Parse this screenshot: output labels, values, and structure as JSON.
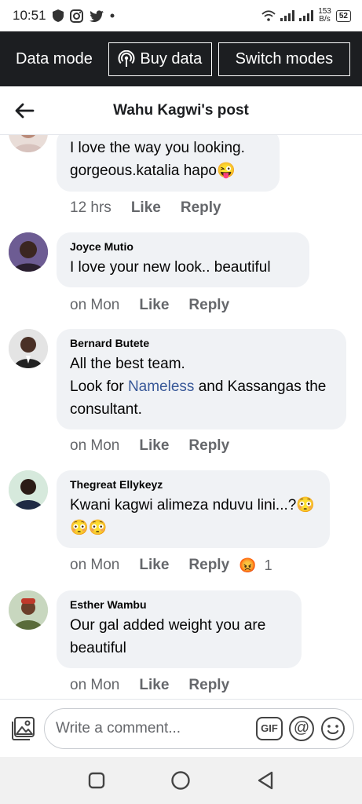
{
  "status_bar": {
    "time": "10:51",
    "speed_value": "153",
    "speed_unit": "B/s",
    "battery": "52"
  },
  "data_bar": {
    "label": "Data mode",
    "buy_data": "Buy data",
    "switch_modes": "Switch modes"
  },
  "header": {
    "title": "Wahu Kagwi's post"
  },
  "comments": [
    {
      "name": "",
      "text": "I love the way you looking. gorgeous.katalia hapo😜",
      "time": "12 hrs",
      "like": "Like",
      "reply": "Reply"
    },
    {
      "name": "Joyce Mutio",
      "text": "I love your new look.. beautiful",
      "time": "on Mon",
      "like": "Like",
      "reply": "Reply"
    },
    {
      "name": "Bernard Butete",
      "text_before": "All the best team.",
      "text_prefix": "Look for ",
      "link": "Nameless",
      "text_suffix": " and Kassangas the consultant.",
      "time": "on Mon",
      "like": "Like",
      "reply": "Reply"
    },
    {
      "name": "Thegreat Ellykeyz",
      "text": "Kwani kagwi alimeza nduvu lini...?😳😳😳",
      "time": "on Mon",
      "like": "Like",
      "reply": "Reply",
      "reaction_emoji": "😡",
      "reaction_count": "1"
    },
    {
      "name": "Esther Wambu",
      "text": "Our gal added weight you are beautiful",
      "time": "on Mon",
      "like": "Like",
      "reply": "Reply"
    }
  ],
  "composer": {
    "placeholder": "Write a comment...",
    "gif_label": "GIF",
    "at_label": "@"
  },
  "icons": {
    "back": "arrow-left-icon",
    "gallery": "photo-gallery-icon",
    "gif": "gif-icon",
    "mention": "at-icon",
    "emoji": "smiley-icon",
    "recents": "square-icon",
    "home": "circle-icon",
    "nav_back": "triangle-back-icon"
  },
  "colors": {
    "data_bar_bg": "#1c1e21",
    "bubble_bg": "#f0f2f5",
    "link": "#385898",
    "meta_text": "#65676b"
  }
}
